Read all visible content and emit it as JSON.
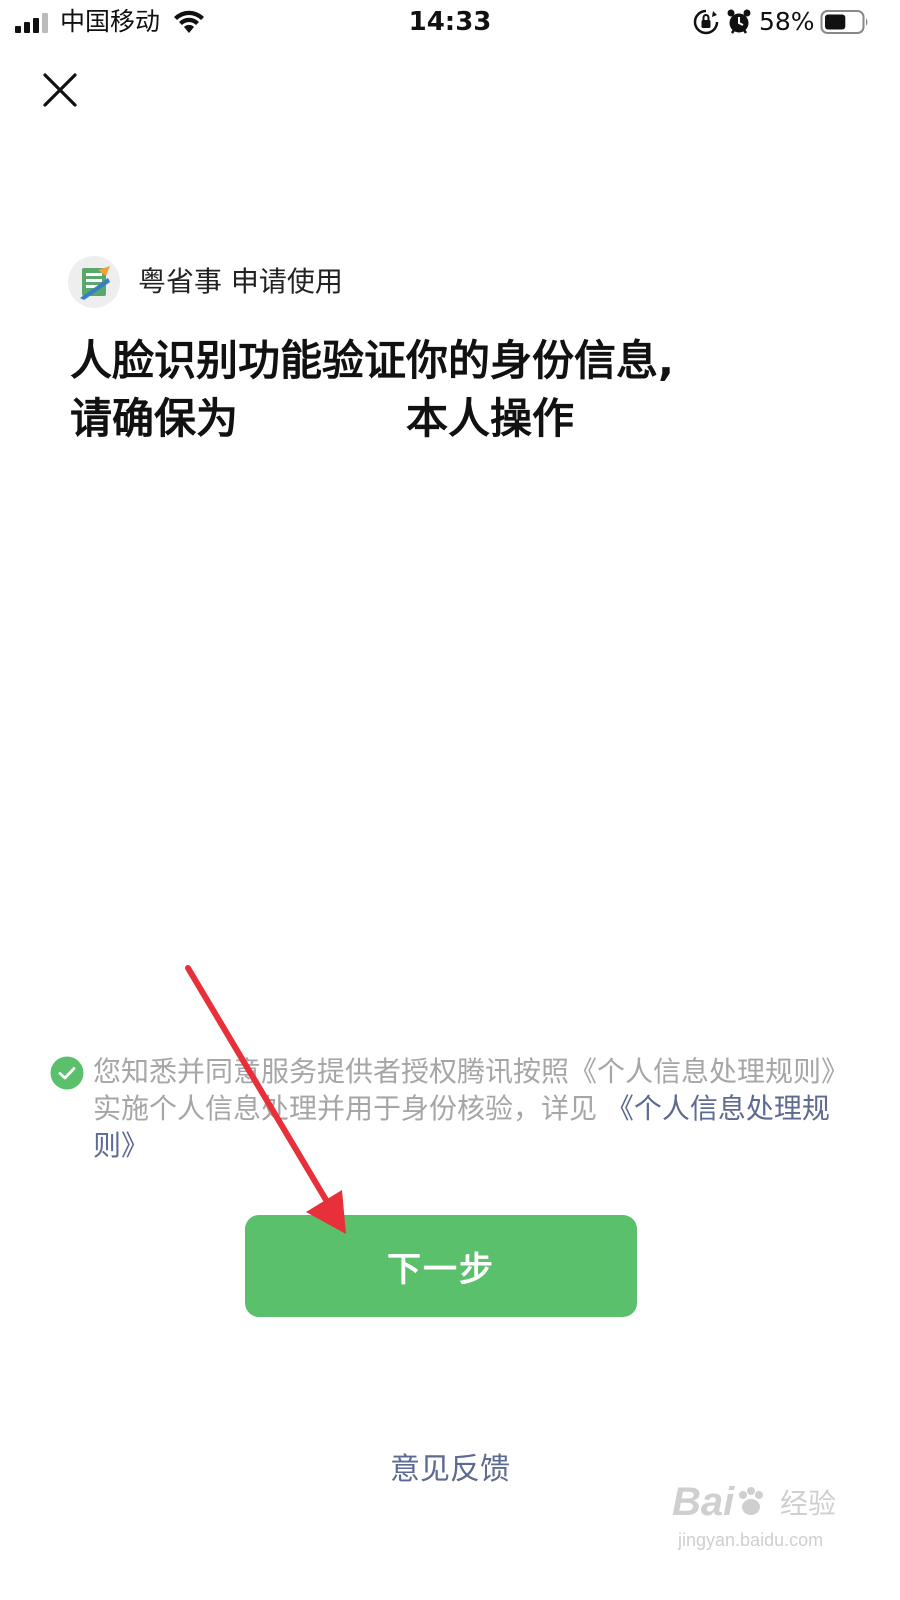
{
  "status_bar": {
    "carrier": "中国移动",
    "time": "14:33",
    "battery_percent": "58%",
    "battery_level": 0.58,
    "icons": [
      "signal-icon",
      "wifi-icon",
      "orientation-lock-icon",
      "alarm-icon",
      "battery-icon"
    ]
  },
  "header": {
    "close_icon": "close-icon"
  },
  "app": {
    "name_request": "粤省事 申请使用",
    "logo_icon": "yue-app-logo-icon"
  },
  "title": {
    "line1": "人脸识别功能验证你的身份信息,",
    "line2_start": "请确保为",
    "line2_end": "本人操作"
  },
  "agreement": {
    "checked": true,
    "text": "您知悉并同意服务提供者授权腾讯按照《个人信息处理规则》实施个人信息处理并用于身份核验，详见 ",
    "link": "《个人信息处理规则》",
    "check_color": "#5ac06b",
    "link_color": "#5d6a91"
  },
  "actions": {
    "next_label": "下一步",
    "next_color": "#5ac06b",
    "feedback_label": "意见反馈"
  },
  "annotation": {
    "arrow_color": "#e8303a"
  },
  "watermark": {
    "brand": "Bai",
    "brand_suffix": "经验",
    "url": "jingyan.baidu.com"
  }
}
